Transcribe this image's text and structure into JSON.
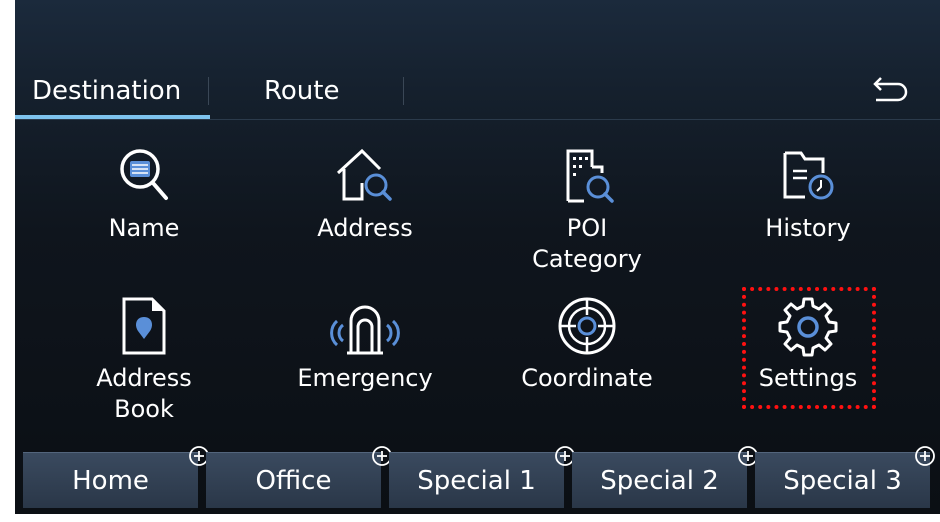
{
  "tabs": {
    "destination": "Destination",
    "route": "Route"
  },
  "menu": {
    "name": "Name",
    "address": "Address",
    "poi_line1": "POI",
    "poi_line2": "Category",
    "history": "History",
    "address_book_line1": "Address",
    "address_book_line2": "Book",
    "emergency": "Emergency",
    "coordinate": "Coordinate",
    "settings": "Settings"
  },
  "favorites": [
    "Home",
    "Office",
    "Special 1",
    "Special 2",
    "Special 3"
  ],
  "icons": {
    "back": "back-arrow-icon",
    "name": "search-list-icon",
    "address": "house-search-icon",
    "poi": "building-search-icon",
    "history": "folder-clock-icon",
    "address_book": "document-pin-icon",
    "emergency": "emergency-signal-icon",
    "coordinate": "target-icon",
    "settings": "gear-icon",
    "add": "plus-circle-icon"
  },
  "colors": {
    "accent": "#7ec3ee",
    "icon_blue": "#5a8fd8",
    "highlight_box": "#ff1111"
  }
}
